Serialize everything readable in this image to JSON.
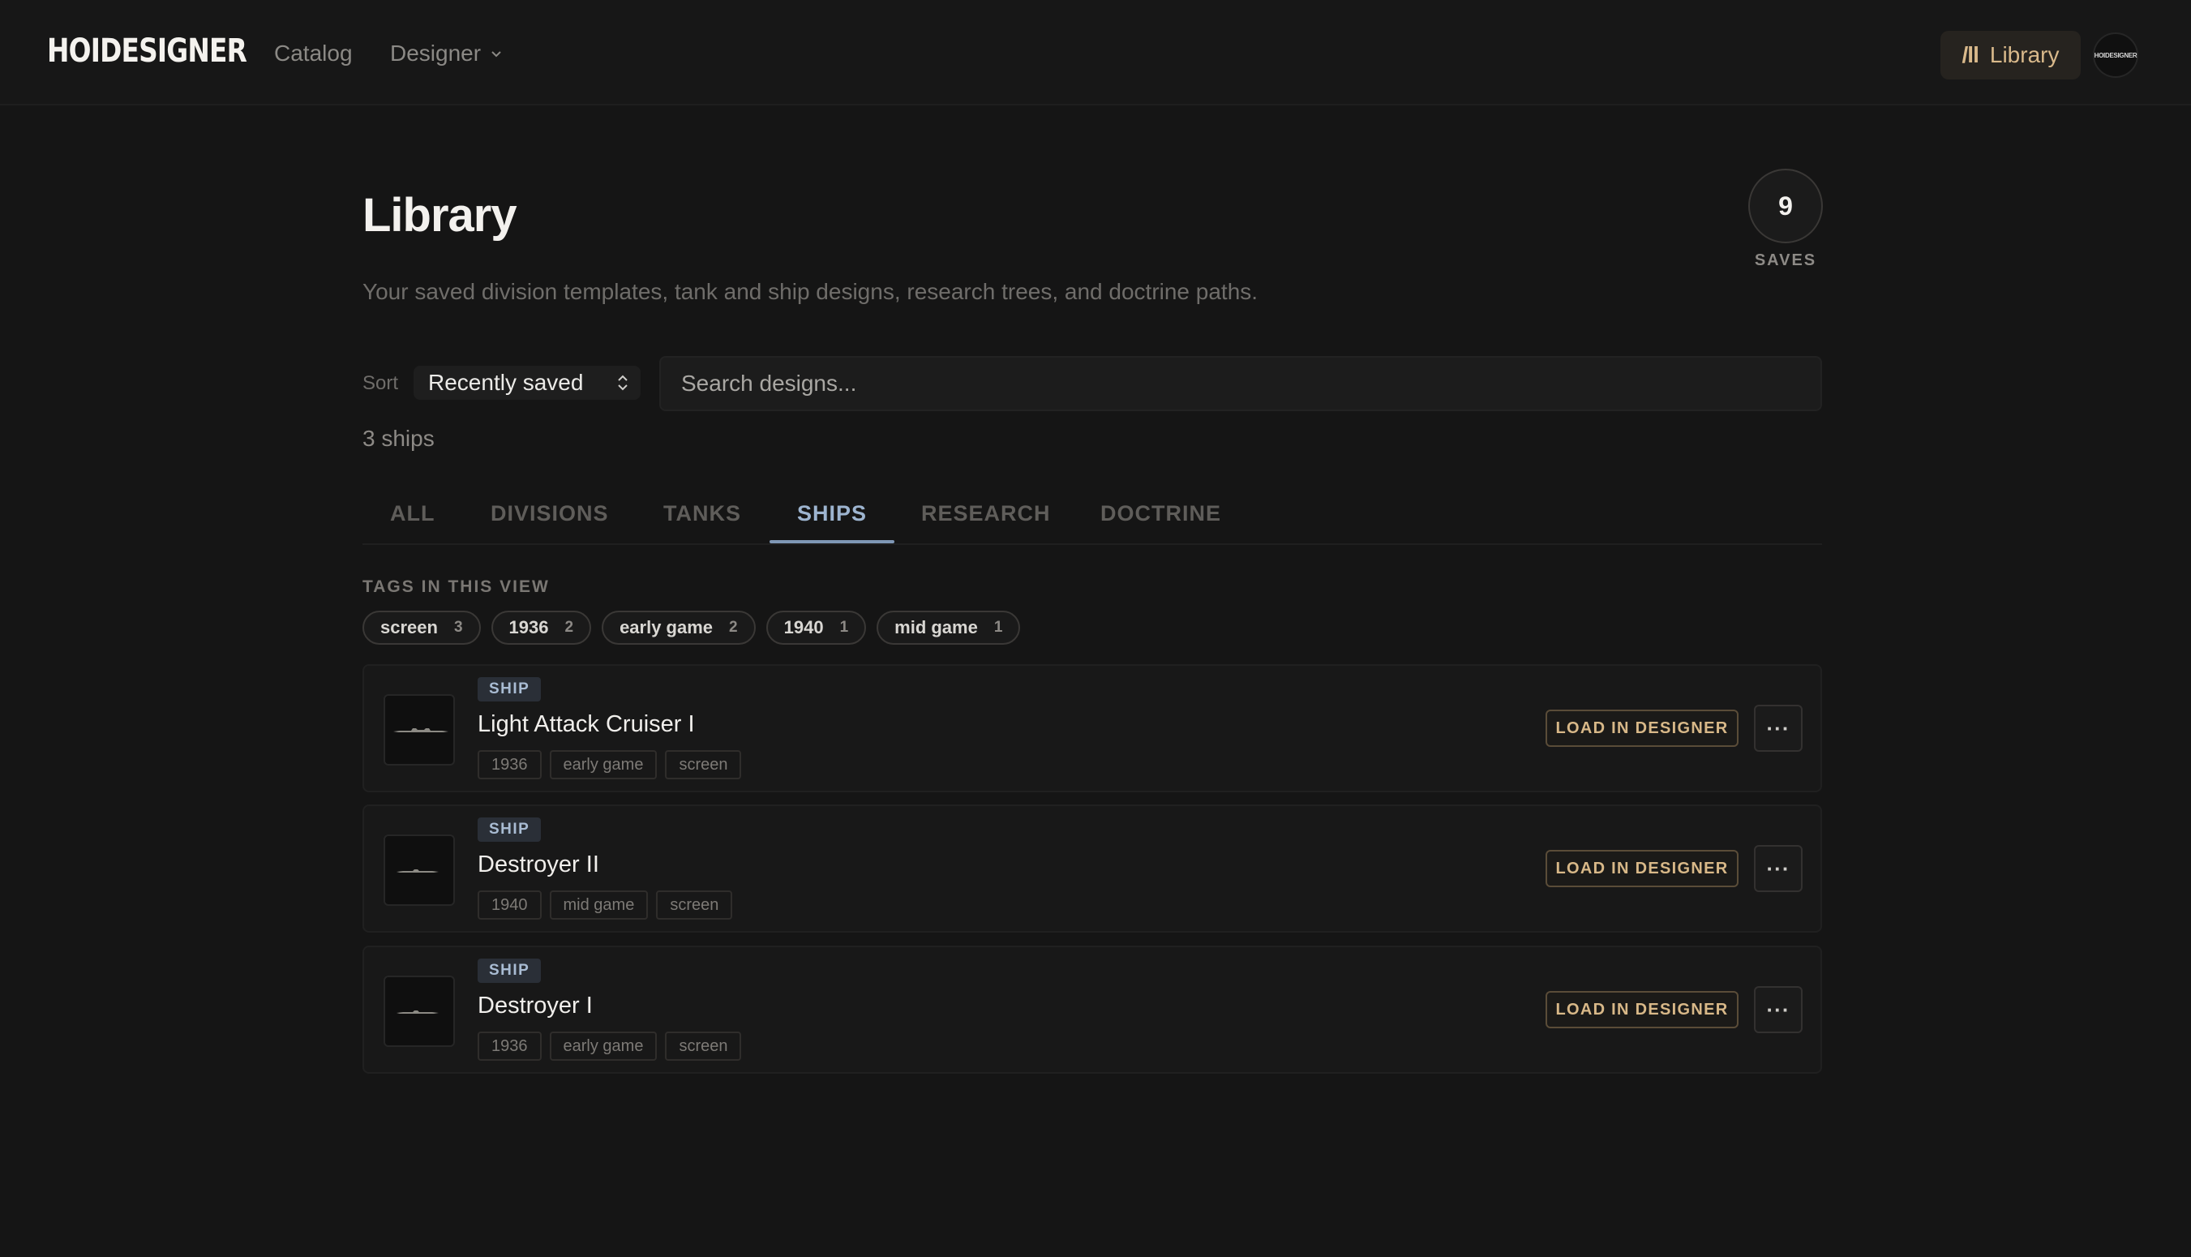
{
  "nav": {
    "brand": "HOIDESIGNER",
    "links": [
      "Catalog",
      "Designer"
    ],
    "library_button": "Library",
    "library_icon": "/ll",
    "avatar_text": "HOIDESIGNER"
  },
  "header": {
    "title": "Library",
    "subtitle": "Your saved division templates, tank and ship designs, research trees, and doctrine paths.",
    "saves_count": "9",
    "saves_label": "SAVES"
  },
  "controls": {
    "sort_label": "Sort",
    "sort_value": "Recently saved",
    "search_placeholder": "Search designs...",
    "result_count": "3 ships"
  },
  "tabs": {
    "items": [
      "ALL",
      "DIVISIONS",
      "TANKS",
      "SHIPS",
      "RESEARCH",
      "DOCTRINE"
    ],
    "active": "SHIPS"
  },
  "tags": {
    "heading": "TAGS IN THIS VIEW",
    "items": [
      {
        "label": "screen",
        "count": "3"
      },
      {
        "label": "1936",
        "count": "2"
      },
      {
        "label": "early game",
        "count": "2"
      },
      {
        "label": "1940",
        "count": "1"
      },
      {
        "label": "mid game",
        "count": "1"
      }
    ]
  },
  "designs": [
    {
      "type": "SHIP",
      "title": "Light Attack Cruiser I",
      "tags": [
        "1936",
        "early game",
        "screen"
      ],
      "action": "LOAD IN DESIGNER",
      "more": "···"
    },
    {
      "type": "SHIP",
      "title": "Destroyer II",
      "tags": [
        "1940",
        "mid game",
        "screen"
      ],
      "action": "LOAD IN DESIGNER",
      "more": "···"
    },
    {
      "type": "SHIP",
      "title": "Destroyer I",
      "tags": [
        "1936",
        "early game",
        "screen"
      ],
      "action": "LOAD IN DESIGNER",
      "more": "···"
    }
  ],
  "colors": {
    "background": "#151515",
    "accent_gold": "#d8b888",
    "accent_blue": "#9db4cf"
  }
}
